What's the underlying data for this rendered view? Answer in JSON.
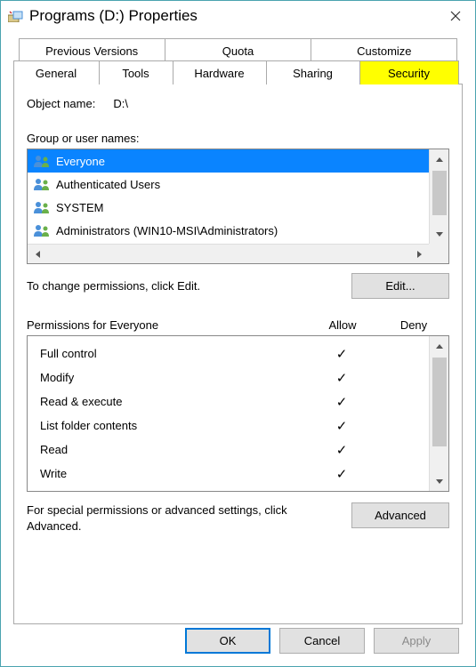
{
  "window": {
    "title": "Programs (D:) Properties"
  },
  "tabs": {
    "row1": [
      {
        "label": "Previous Versions"
      },
      {
        "label": "Quota"
      },
      {
        "label": "Customize"
      }
    ],
    "row2": [
      {
        "label": "General"
      },
      {
        "label": "Tools"
      },
      {
        "label": "Hardware"
      },
      {
        "label": "Sharing"
      },
      {
        "label": "Security"
      }
    ],
    "active": "Security"
  },
  "object": {
    "label": "Object name:",
    "value": "D:\\"
  },
  "groups": {
    "label": "Group or user names:",
    "items": [
      {
        "label": "Everyone",
        "selected": true
      },
      {
        "label": "Authenticated Users",
        "selected": false
      },
      {
        "label": "SYSTEM",
        "selected": false
      },
      {
        "label": "Administrators (WIN10-MSI\\Administrators)",
        "selected": false
      }
    ]
  },
  "edit": {
    "text": "To change permissions, click Edit.",
    "button": "Edit..."
  },
  "permissions": {
    "header_label": "Permissions for Everyone",
    "col_allow": "Allow",
    "col_deny": "Deny",
    "rows": [
      {
        "name": "Full control",
        "allow": true,
        "deny": false
      },
      {
        "name": "Modify",
        "allow": true,
        "deny": false
      },
      {
        "name": "Read & execute",
        "allow": true,
        "deny": false
      },
      {
        "name": "List folder contents",
        "allow": true,
        "deny": false
      },
      {
        "name": "Read",
        "allow": true,
        "deny": false
      },
      {
        "name": "Write",
        "allow": true,
        "deny": false
      }
    ]
  },
  "advanced": {
    "text": "For special permissions or advanced settings, click Advanced.",
    "button": "Advanced"
  },
  "footer": {
    "ok": "OK",
    "cancel": "Cancel",
    "apply": "Apply"
  }
}
